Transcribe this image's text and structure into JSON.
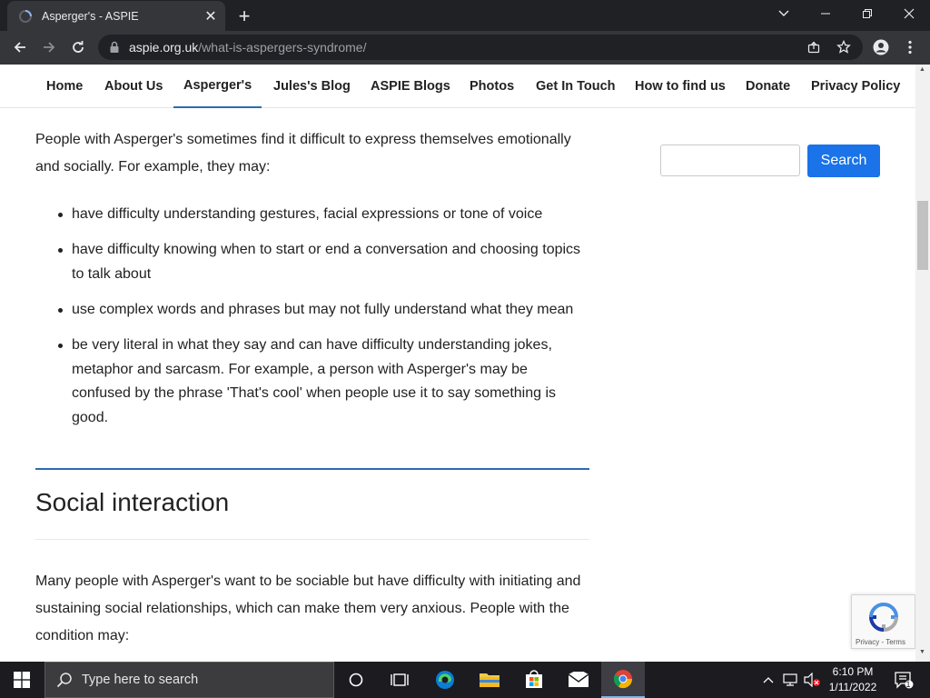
{
  "browser": {
    "tab_title": "Asperger's - ASPIE",
    "url_host": "aspie.org.uk",
    "url_path": "/what-is-aspergers-syndrome/"
  },
  "nav": {
    "items": [
      "Home",
      "About Us",
      "Asperger's",
      "Jules's Blog",
      "ASPIE Blogs",
      "Photos",
      "Get In Touch",
      "How to find us",
      "Donate",
      "Privacy Policy"
    ],
    "active": "Asperger's"
  },
  "content": {
    "intro": "People with Asperger's sometimes find it difficult to express themselves emotionally and socially. For example, they may:",
    "bullets": [
      "have difficulty understanding gestures, facial expressions or tone of voice",
      "have difficulty knowing when to start or end a conversation and choosing topics to talk about",
      "use complex words and phrases but may not fully understand what they mean",
      "be very literal in what they say and can have difficulty understanding jokes, metaphor and sarcasm. For example, a person with Asperger's may be confused by the phrase 'That's cool' when people use it to say something is good."
    ],
    "heading": "Social interaction",
    "para2": "Many people with Asperger's want to be sociable but have difficulty with initiating and sustaining social relationships, which can make them very anxious. People with the condition may:"
  },
  "sidebar": {
    "search_button": "Search"
  },
  "recaptcha": {
    "links": "Privacy - Terms"
  },
  "taskbar": {
    "search_placeholder": "Type here to search",
    "time": "6:10 PM",
    "date": "1/11/2022",
    "notification_count": "1"
  },
  "colors": {
    "accent": "#2b6cb0",
    "search_button": "#1a73e8",
    "chrome_dark": "#202124",
    "chrome_toolbar": "#35363a"
  }
}
